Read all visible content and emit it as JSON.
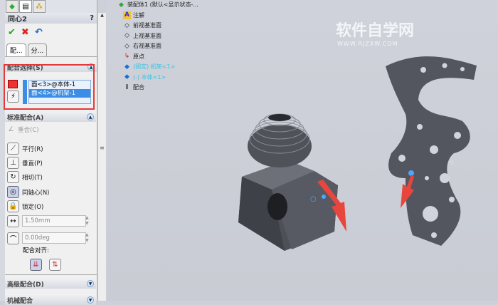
{
  "panel": {
    "tabs": [
      "feature-manager",
      "property-manager",
      "configuration-manager"
    ],
    "title": "同心2",
    "help": "?",
    "actions": {
      "ok": "✔",
      "cancel": "✖",
      "undo": "↶"
    },
    "subtabs": [
      "配...",
      "分..."
    ],
    "mate_selection": {
      "label": "配合选择(S)",
      "items": [
        "面<3>@本体-1",
        "面<4>@机架-1"
      ]
    },
    "standard_mates": {
      "label": "标准配合(A)",
      "items": [
        {
          "label": "重合(C)",
          "enabled": false
        },
        {
          "label": "平行(R)",
          "enabled": true
        },
        {
          "label": "垂直(P)",
          "enabled": true
        },
        {
          "label": "相切(T)",
          "enabled": true
        },
        {
          "label": "同轴心(N)",
          "enabled": true,
          "selected": true
        },
        {
          "label": "锁定(O)",
          "enabled": true
        }
      ],
      "distance": "1.50mm",
      "angle": "0.00deg",
      "alignment_label": "配合对齐:"
    },
    "advanced_mates": {
      "label": "高级配合(D)"
    },
    "mechanical_mates": {
      "label": "机械配合"
    }
  },
  "tree": {
    "root": "装配体1 (默认<显示状态-...",
    "items": [
      {
        "label": "注解",
        "icon": "annotation-icon"
      },
      {
        "label": "前视基准面",
        "icon": "plane-icon"
      },
      {
        "label": "上视基准面",
        "icon": "plane-icon"
      },
      {
        "label": "右视基准面",
        "icon": "plane-icon"
      },
      {
        "label": "原点",
        "icon": "origin-icon"
      },
      {
        "label": "(固定) 机架<1>",
        "icon": "part-icon"
      },
      {
        "label": "(-) 本体<1>",
        "icon": "part-icon"
      },
      {
        "label": "配合",
        "icon": "mates-icon"
      }
    ]
  },
  "watermark": {
    "title": "软件自学网",
    "url": "WWW.RJZXW.COM"
  },
  "colors": {
    "highlight": "#e23a3a",
    "selection": "#3b8ee6",
    "tree_cyan": "#2fc6e6"
  }
}
